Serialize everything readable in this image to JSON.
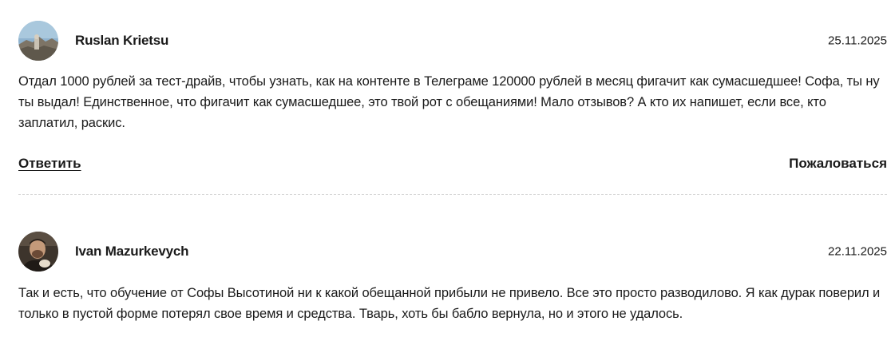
{
  "reviews": [
    {
      "author": "Ruslan Krietsu",
      "date": "25.11.2025",
      "text": "Отдал 1000 рублей за тест-драйв, чтобы узнать, как на контенте в Телеграме 120000 рублей в месяц фигачит как сумасшедшее! Софа, ты ну ты выдал! Единственное, что фигачит как сумасшедшее, это твой рот с обещаниями! Мало отзывов? А кто их напишет, если все, кто заплатил, раскис.",
      "reply_label": "Ответить",
      "report_label": "Пожаловаться"
    },
    {
      "author": "Ivan Mazurkevych",
      "date": "22.11.2025",
      "text": "Так и есть, что обучение от Софы Высотиной ни к какой обещанной прибыли не привело. Все это просто разводилово. Я как дурак поверил и только в пустой форме потерял свое время и средства. Тварь, хоть бы бабло вернула, но и этого не удалось."
    }
  ]
}
